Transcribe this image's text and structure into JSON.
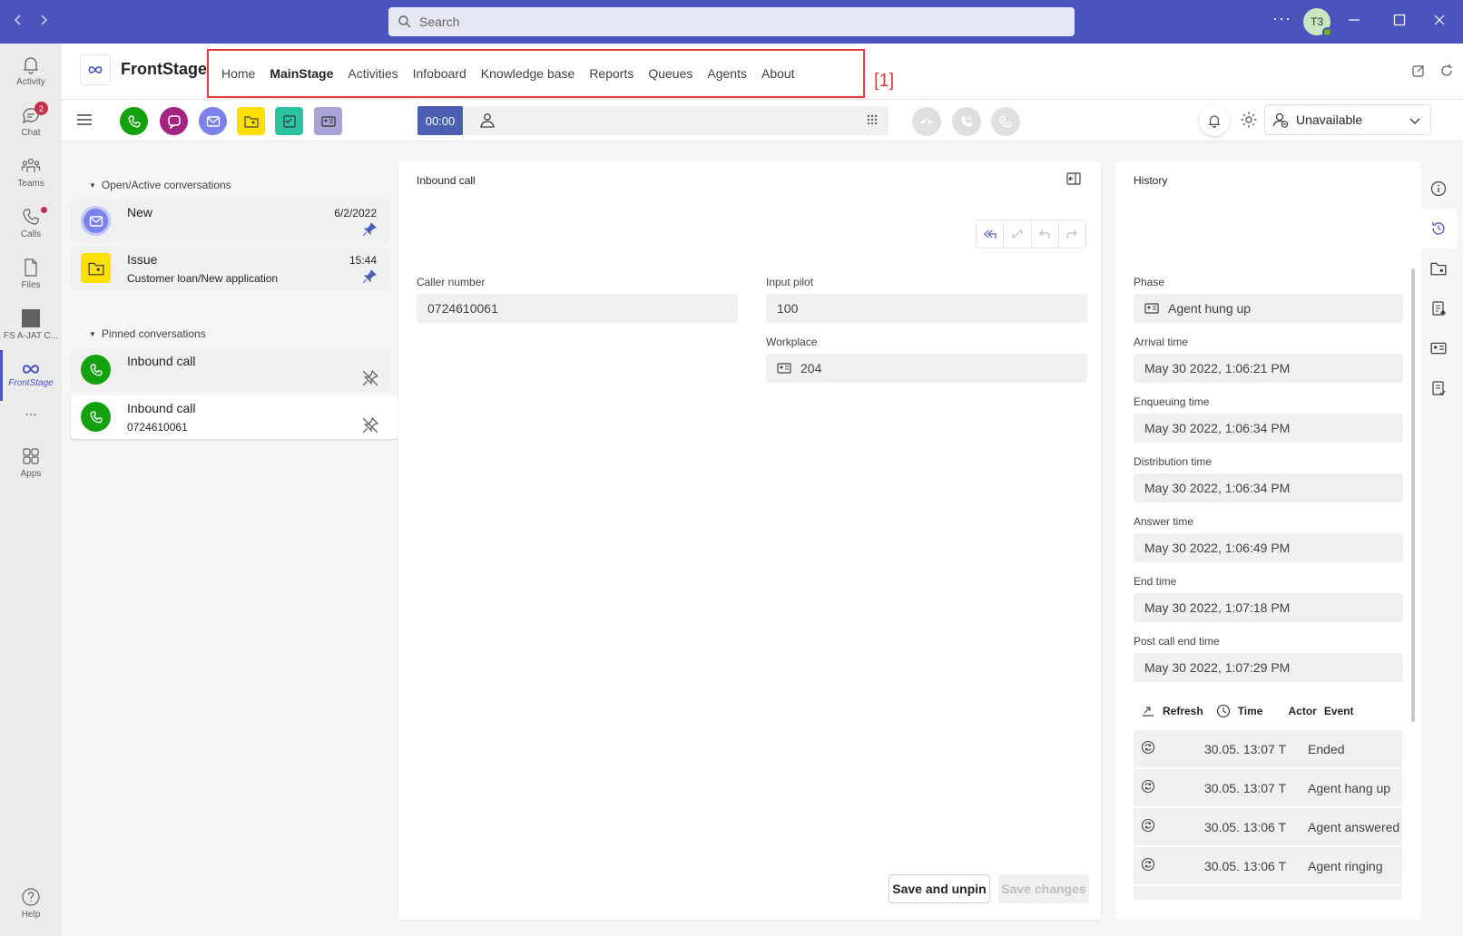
{
  "titlebar": {
    "search_placeholder": "Search",
    "avatar_initials": "T3"
  },
  "rail": {
    "items": [
      {
        "label": "Activity",
        "icon": "bell-icon"
      },
      {
        "label": "Chat",
        "icon": "chat-icon",
        "badge": "2"
      },
      {
        "label": "Teams",
        "icon": "teams-icon"
      },
      {
        "label": "Calls",
        "icon": "phone-icon"
      },
      {
        "label": "Files",
        "icon": "file-icon"
      },
      {
        "label": "FS A-JAT C...",
        "icon": "app-square-icon"
      },
      {
        "label": "FrontStage",
        "icon": "infinity-icon"
      },
      {
        "label": "...",
        "icon": "more-icon"
      },
      {
        "label": "Apps",
        "icon": "apps-icon"
      },
      {
        "label": "Help",
        "icon": "help-icon"
      }
    ]
  },
  "app": {
    "name": "FrontStage",
    "tabs": [
      "Home",
      "MainStage",
      "Activities",
      "Infoboard",
      "Knowledge base",
      "Reports",
      "Queues",
      "Agents",
      "About"
    ],
    "selected_tab": "MainStage",
    "annotation": "[1]"
  },
  "toolbar": {
    "timer": "00:00",
    "status": "Unavailable"
  },
  "conversations": {
    "open_header": "Open/Active conversations",
    "pinned_header": "Pinned conversations",
    "open": [
      {
        "title": "New",
        "subtitle": "",
        "time": "6/2/2022"
      },
      {
        "title": "Issue",
        "subtitle": "Customer loan/New application",
        "time": "15:44"
      }
    ],
    "pinned": [
      {
        "title": "Inbound call",
        "subtitle": ""
      },
      {
        "title": "Inbound call",
        "subtitle": "0724610061"
      }
    ]
  },
  "detail": {
    "title": "Inbound call",
    "caller_number_label": "Caller number",
    "caller_number": "0724610061",
    "input_pilot_label": "Input pilot",
    "input_pilot": "100",
    "workplace_label": "Workplace",
    "workplace": "204",
    "save_unpin": "Save and unpin",
    "save_changes": "Save changes"
  },
  "history": {
    "title": "History",
    "fields": [
      {
        "label": "Phase",
        "value": "Agent hung up"
      },
      {
        "label": "Arrival time",
        "value": "May 30 2022, 1:06:21 PM"
      },
      {
        "label": "Enqueuing time",
        "value": "May 30 2022, 1:06:34 PM"
      },
      {
        "label": "Distribution time",
        "value": "May 30 2022, 1:06:34 PM"
      },
      {
        "label": "Answer time",
        "value": "May 30 2022, 1:06:49 PM"
      },
      {
        "label": "End time",
        "value": "May 30 2022, 1:07:18 PM"
      },
      {
        "label": "Post call end time",
        "value": "May 30 2022, 1:07:29 PM"
      }
    ],
    "table_headers": {
      "refresh": "Refresh",
      "time": "Time",
      "actor": "Actor",
      "event": "Event"
    },
    "rows": [
      {
        "time": "30.05. 13:07 T",
        "event": "Ended"
      },
      {
        "time": "30.05. 13:07 T",
        "event": "Agent hang up"
      },
      {
        "time": "30.05. 13:06 T",
        "event": "Agent answered"
      },
      {
        "time": "30.05. 13:06 T",
        "event": "Agent ringing"
      }
    ]
  },
  "colors": {
    "titlebar": "#4b53bc",
    "accent": "#4b5fb3",
    "call_green": "#13a10e",
    "chat_purple": "#a4262c",
    "highlight_red": "#e23c3c"
  }
}
